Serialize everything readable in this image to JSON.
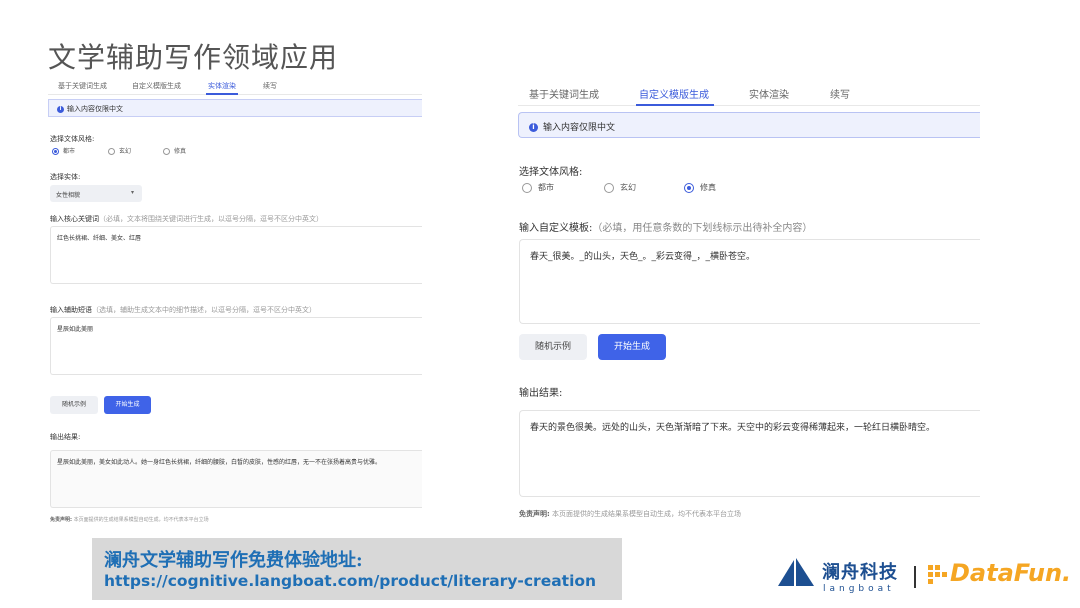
{
  "slide_title": "文学辅助写作领域应用",
  "left_panel": {
    "tabs": [
      "基于关键词生成",
      "自定义模版生成",
      "实体渲染",
      "续写"
    ],
    "active_tab": 2,
    "notice": "输入内容仅限中文",
    "style_label": "选择文体风格:",
    "style_options": [
      "都市",
      "玄幻",
      "修真"
    ],
    "selected_style": 0,
    "entity_label": "选择实体:",
    "entity_value": "女性相貌",
    "keywords_label": "输入核心关键词",
    "keywords_hint": "（必填，文本将围绕关键词进行生成，以逗号分隔，逗号不区分中英文）",
    "keywords_value": "红色长挑裙、纤细、美女、红唇",
    "aux_label": "输入辅助短语",
    "aux_hint": "（选填，辅助生成文本中的细节描述，以逗号分隔，逗号不区分中英文）",
    "aux_value": "星辰如此美丽",
    "random_button": "随机示例",
    "generate_button": "开始生成",
    "output_label": "输出结果:",
    "output_value": "星辰如此美丽，美女如此动人。她一身红色长挑裙，纤细的腰肢，白皙的皮肤，性感的红唇，无一不在张扬着高贵与优雅。",
    "disclaimer_label": "免责声明:",
    "disclaimer_text": "本页面提供的生成结果系模型自动生成，均不代表本平台立场"
  },
  "right_panel": {
    "tabs": [
      "基于关键词生成",
      "自定义模版生成",
      "实体渲染",
      "续写"
    ],
    "active_tab": 1,
    "notice": "输入内容仅限中文",
    "style_label": "选择文体风格:",
    "style_options": [
      "都市",
      "玄幻",
      "修真"
    ],
    "selected_style": 2,
    "template_label": "输入自定义模板:",
    "template_hint": "（必填，用任意条数的下划线标示出待补全内容）",
    "template_value": "春天_很美。_的山头，天色_。_彩云变得_，_横卧苍空。",
    "random_button": "随机示例",
    "generate_button": "开始生成",
    "output_label": "输出结果:",
    "output_value": "春天的景色很美。远处的山头，天色渐渐暗了下来。天空中的彩云变得稀薄起来，一轮红日横卧晴空。",
    "disclaimer_label": "免责声明:",
    "disclaimer_text": "本页面提供的生成结果系模型自动生成，均不代表本平台立场"
  },
  "banner": {
    "line1": "澜舟文学辅助写作免费体验地址:",
    "line2": "https://cognitive.langboat.com/product/literary-creation"
  },
  "logos": {
    "langboat_cn": "澜舟科技",
    "langboat_en": "langboat",
    "datafun": "DataFun."
  },
  "colors": {
    "accent": "#3b5bdb",
    "button_primary": "#3f63e8",
    "banner_text": "#1f6fb5",
    "langboat": "#1d4f91",
    "datafun": "#f5a623"
  }
}
